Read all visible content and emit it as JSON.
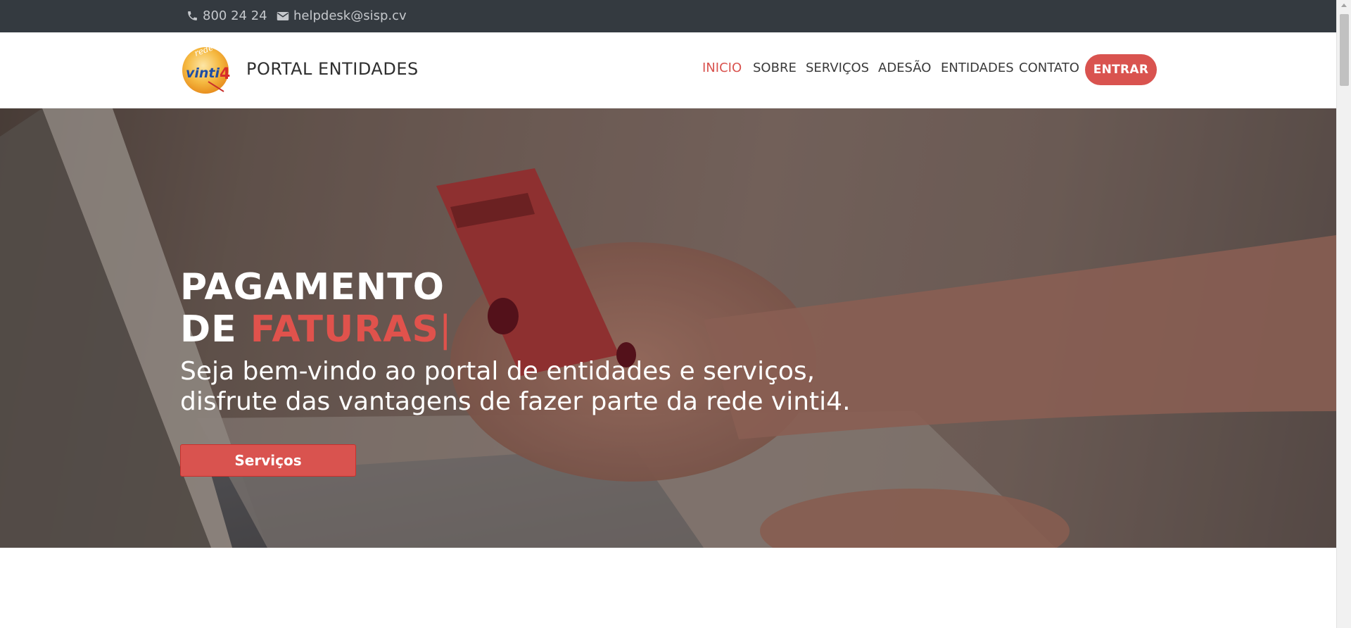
{
  "topbar": {
    "phone": "800 24 24",
    "email": "helpdesk@sisp.cv"
  },
  "brand": {
    "logo_top": "rede",
    "logo_main": "vinti4",
    "title": "PORTAL ENTIDADES"
  },
  "nav": {
    "items": [
      {
        "label": "INICIO",
        "active": true
      },
      {
        "label": "SOBRE",
        "active": false
      },
      {
        "label": "SERVIÇOS",
        "active": false
      },
      {
        "label": "ADESÃO",
        "active": false
      },
      {
        "label": "ENTIDADES",
        "active": false
      },
      {
        "label": "CONTATO",
        "active": false
      }
    ],
    "cta": "ENTRAR"
  },
  "hero": {
    "title_line1": "PAGAMENTO",
    "title_line2_prefix": "DE ",
    "title_line2_accent": "FATURAS",
    "cursor": "|",
    "subtitle_line1": "Seja bem-vindo ao portal de entidades e serviços,",
    "subtitle_line2": "disfrute das vantagens de fazer parte da rede vinti4.",
    "button": "Serviços"
  },
  "colors": {
    "accent": "#d9534f",
    "topbar": "#343a40"
  }
}
